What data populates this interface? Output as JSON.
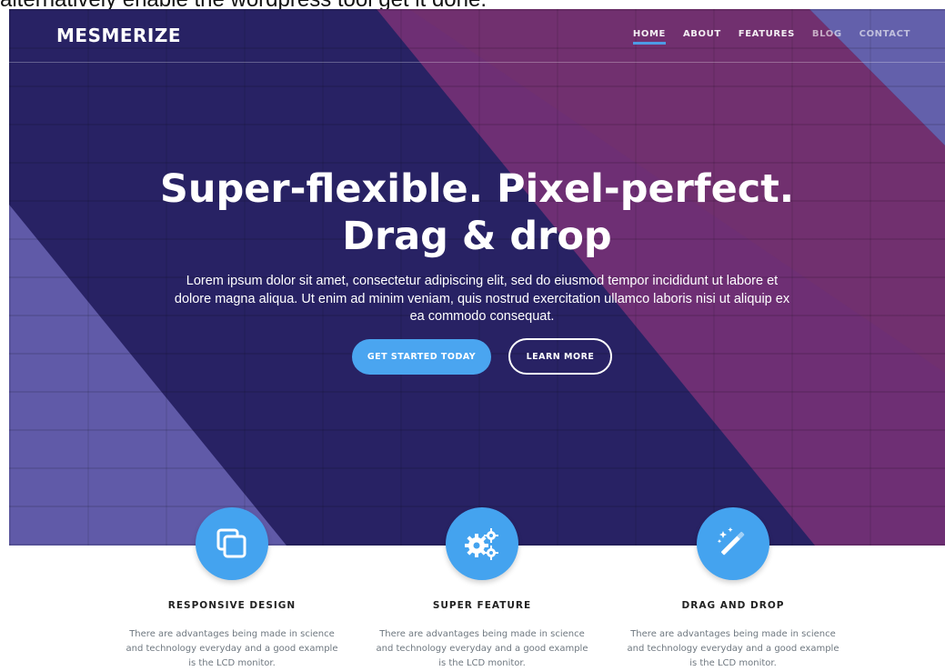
{
  "caption": "alternatively enable the wordpress tool get it done.",
  "nav": {
    "logo": "MESMERIZE",
    "items": [
      {
        "label": "HOME",
        "active": true
      },
      {
        "label": "ABOUT"
      },
      {
        "label": "FEATURES"
      },
      {
        "label": "BLOG"
      },
      {
        "label": "CONTACT"
      }
    ]
  },
  "hero": {
    "headline_line1": "Super-flexible. Pixel-perfect.",
    "headline_line2": "Drag & drop",
    "lead": "Lorem ipsum dolor sit amet, consectetur adipiscing elit, sed do eiusmod tempor incididunt ut labore et dolore magna aliqua. Ut enim ad minim veniam, quis nostrud exercitation ullamco laboris nisi ut aliquip ex ea commodo consequat.",
    "primary_button": "GET STARTED TODAY",
    "secondary_button": "LEARN MORE"
  },
  "features": [
    {
      "icon": "copy-icon",
      "title": "RESPONSIVE DESIGN",
      "desc": "There are advantages being made in science and technology everyday and a good example is the LCD monitor."
    },
    {
      "icon": "gears-icon",
      "title": "SUPER FEATURE",
      "desc": "There are advantages being made in science and technology everyday and a good example is the LCD monitor."
    },
    {
      "icon": "magic-wand-icon",
      "title": "DRAG AND DROP",
      "desc": "There are advantages being made in science and technology everyday and a good example is the LCD monitor."
    }
  ],
  "colors": {
    "accent": "#4aa5f0",
    "hero_dark": "#2a2466",
    "hero_pink": "#7a3479",
    "hero_light": "#6a65b4"
  }
}
